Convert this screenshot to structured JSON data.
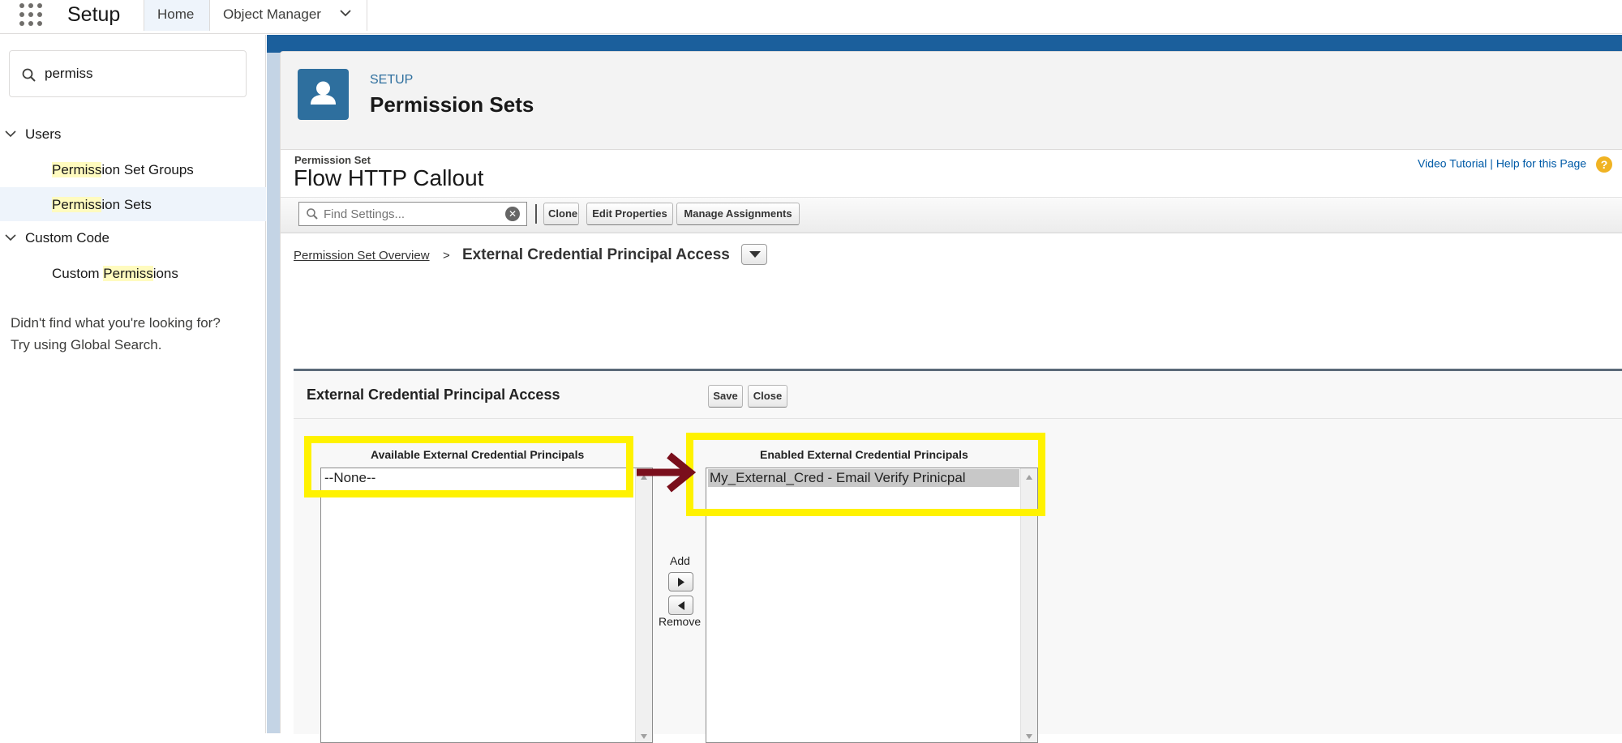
{
  "topbar": {
    "app_title": "Setup",
    "tabs": [
      {
        "label": "Home"
      },
      {
        "label": "Object Manager"
      }
    ]
  },
  "sidebar": {
    "search_value": "permiss",
    "groups": [
      {
        "label": "Users",
        "items": [
          {
            "highlight": "Permiss",
            "rest": "ion Set Groups"
          },
          {
            "highlight": "Permiss",
            "rest": "ion Sets"
          }
        ]
      },
      {
        "label": "Custom Code",
        "items": [
          {
            "prefix": "Custom ",
            "highlight": "Permiss",
            "rest": "ions"
          }
        ]
      }
    ],
    "not_found_line1": "Didn't find what you're looking for?",
    "not_found_line2": "Try using Global Search."
  },
  "header": {
    "eyebrow": "SETUP",
    "title": "Permission Sets"
  },
  "detail": {
    "record_type_label": "Permission Set",
    "record_name": "Flow HTTP Callout",
    "help_video": "Video Tutorial",
    "help_separator": "|",
    "help_page": "Help for this Page",
    "help_icon_glyph": "?"
  },
  "toolbar": {
    "find_placeholder": "Find Settings...",
    "clone_label": "Clone",
    "edit_properties_label": "Edit Properties",
    "manage_assignments_label": "Manage Assignments"
  },
  "breadcrumb": {
    "overview_label": "Permission Set Overview",
    "separator": ">",
    "current_label": "External Credential Principal Access"
  },
  "section": {
    "title": "External Credential Principal Access",
    "save_label": "Save",
    "close_label": "Close",
    "available_label": "Available External Credential Principals",
    "available_options": [
      "--None--"
    ],
    "enabled_label": "Enabled External Credential Principals",
    "enabled_options": [
      "My_External_Cred - Email Verify Prinicpal"
    ],
    "add_label": "Add",
    "remove_label": "Remove"
  },
  "annotation": {
    "highlight_color": "#fff200",
    "arrow_color": "#7a0f1c"
  },
  "icons": {
    "app_launcher": "waffle-icon",
    "search": "search-icon",
    "user": "user-icon",
    "clear": "clear-icon",
    "dropdown": "chevron-down-icon",
    "add": "arrow-right-icon",
    "remove": "arrow-left-icon"
  }
}
